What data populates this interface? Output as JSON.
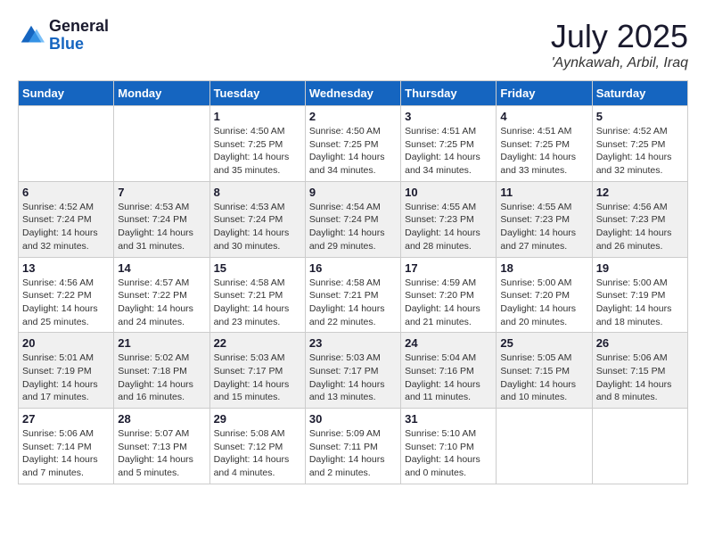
{
  "header": {
    "logo": {
      "general": "General",
      "blue": "Blue"
    },
    "title": "July 2025",
    "location": "'Aynkawah, Arbil, Iraq"
  },
  "calendar": {
    "days": [
      "Sunday",
      "Monday",
      "Tuesday",
      "Wednesday",
      "Thursday",
      "Friday",
      "Saturday"
    ],
    "weeks": [
      [
        {
          "date": "",
          "info": ""
        },
        {
          "date": "",
          "info": ""
        },
        {
          "date": "1",
          "info": "Sunrise: 4:50 AM\nSunset: 7:25 PM\nDaylight: 14 hours\nand 35 minutes."
        },
        {
          "date": "2",
          "info": "Sunrise: 4:50 AM\nSunset: 7:25 PM\nDaylight: 14 hours\nand 34 minutes."
        },
        {
          "date": "3",
          "info": "Sunrise: 4:51 AM\nSunset: 7:25 PM\nDaylight: 14 hours\nand 34 minutes."
        },
        {
          "date": "4",
          "info": "Sunrise: 4:51 AM\nSunset: 7:25 PM\nDaylight: 14 hours\nand 33 minutes."
        },
        {
          "date": "5",
          "info": "Sunrise: 4:52 AM\nSunset: 7:25 PM\nDaylight: 14 hours\nand 32 minutes."
        }
      ],
      [
        {
          "date": "6",
          "info": "Sunrise: 4:52 AM\nSunset: 7:24 PM\nDaylight: 14 hours\nand 32 minutes."
        },
        {
          "date": "7",
          "info": "Sunrise: 4:53 AM\nSunset: 7:24 PM\nDaylight: 14 hours\nand 31 minutes."
        },
        {
          "date": "8",
          "info": "Sunrise: 4:53 AM\nSunset: 7:24 PM\nDaylight: 14 hours\nand 30 minutes."
        },
        {
          "date": "9",
          "info": "Sunrise: 4:54 AM\nSunset: 7:24 PM\nDaylight: 14 hours\nand 29 minutes."
        },
        {
          "date": "10",
          "info": "Sunrise: 4:55 AM\nSunset: 7:23 PM\nDaylight: 14 hours\nand 28 minutes."
        },
        {
          "date": "11",
          "info": "Sunrise: 4:55 AM\nSunset: 7:23 PM\nDaylight: 14 hours\nand 27 minutes."
        },
        {
          "date": "12",
          "info": "Sunrise: 4:56 AM\nSunset: 7:23 PM\nDaylight: 14 hours\nand 26 minutes."
        }
      ],
      [
        {
          "date": "13",
          "info": "Sunrise: 4:56 AM\nSunset: 7:22 PM\nDaylight: 14 hours\nand 25 minutes."
        },
        {
          "date": "14",
          "info": "Sunrise: 4:57 AM\nSunset: 7:22 PM\nDaylight: 14 hours\nand 24 minutes."
        },
        {
          "date": "15",
          "info": "Sunrise: 4:58 AM\nSunset: 7:21 PM\nDaylight: 14 hours\nand 23 minutes."
        },
        {
          "date": "16",
          "info": "Sunrise: 4:58 AM\nSunset: 7:21 PM\nDaylight: 14 hours\nand 22 minutes."
        },
        {
          "date": "17",
          "info": "Sunrise: 4:59 AM\nSunset: 7:20 PM\nDaylight: 14 hours\nand 21 minutes."
        },
        {
          "date": "18",
          "info": "Sunrise: 5:00 AM\nSunset: 7:20 PM\nDaylight: 14 hours\nand 20 minutes."
        },
        {
          "date": "19",
          "info": "Sunrise: 5:00 AM\nSunset: 7:19 PM\nDaylight: 14 hours\nand 18 minutes."
        }
      ],
      [
        {
          "date": "20",
          "info": "Sunrise: 5:01 AM\nSunset: 7:19 PM\nDaylight: 14 hours\nand 17 minutes."
        },
        {
          "date": "21",
          "info": "Sunrise: 5:02 AM\nSunset: 7:18 PM\nDaylight: 14 hours\nand 16 minutes."
        },
        {
          "date": "22",
          "info": "Sunrise: 5:03 AM\nSunset: 7:17 PM\nDaylight: 14 hours\nand 15 minutes."
        },
        {
          "date": "23",
          "info": "Sunrise: 5:03 AM\nSunset: 7:17 PM\nDaylight: 14 hours\nand 13 minutes."
        },
        {
          "date": "24",
          "info": "Sunrise: 5:04 AM\nSunset: 7:16 PM\nDaylight: 14 hours\nand 11 minutes."
        },
        {
          "date": "25",
          "info": "Sunrise: 5:05 AM\nSunset: 7:15 PM\nDaylight: 14 hours\nand 10 minutes."
        },
        {
          "date": "26",
          "info": "Sunrise: 5:06 AM\nSunset: 7:15 PM\nDaylight: 14 hours\nand 8 minutes."
        }
      ],
      [
        {
          "date": "27",
          "info": "Sunrise: 5:06 AM\nSunset: 7:14 PM\nDaylight: 14 hours\nand 7 minutes."
        },
        {
          "date": "28",
          "info": "Sunrise: 5:07 AM\nSunset: 7:13 PM\nDaylight: 14 hours\nand 5 minutes."
        },
        {
          "date": "29",
          "info": "Sunrise: 5:08 AM\nSunset: 7:12 PM\nDaylight: 14 hours\nand 4 minutes."
        },
        {
          "date": "30",
          "info": "Sunrise: 5:09 AM\nSunset: 7:11 PM\nDaylight: 14 hours\nand 2 minutes."
        },
        {
          "date": "31",
          "info": "Sunrise: 5:10 AM\nSunset: 7:10 PM\nDaylight: 14 hours\nand 0 minutes."
        },
        {
          "date": "",
          "info": ""
        },
        {
          "date": "",
          "info": ""
        }
      ]
    ]
  }
}
